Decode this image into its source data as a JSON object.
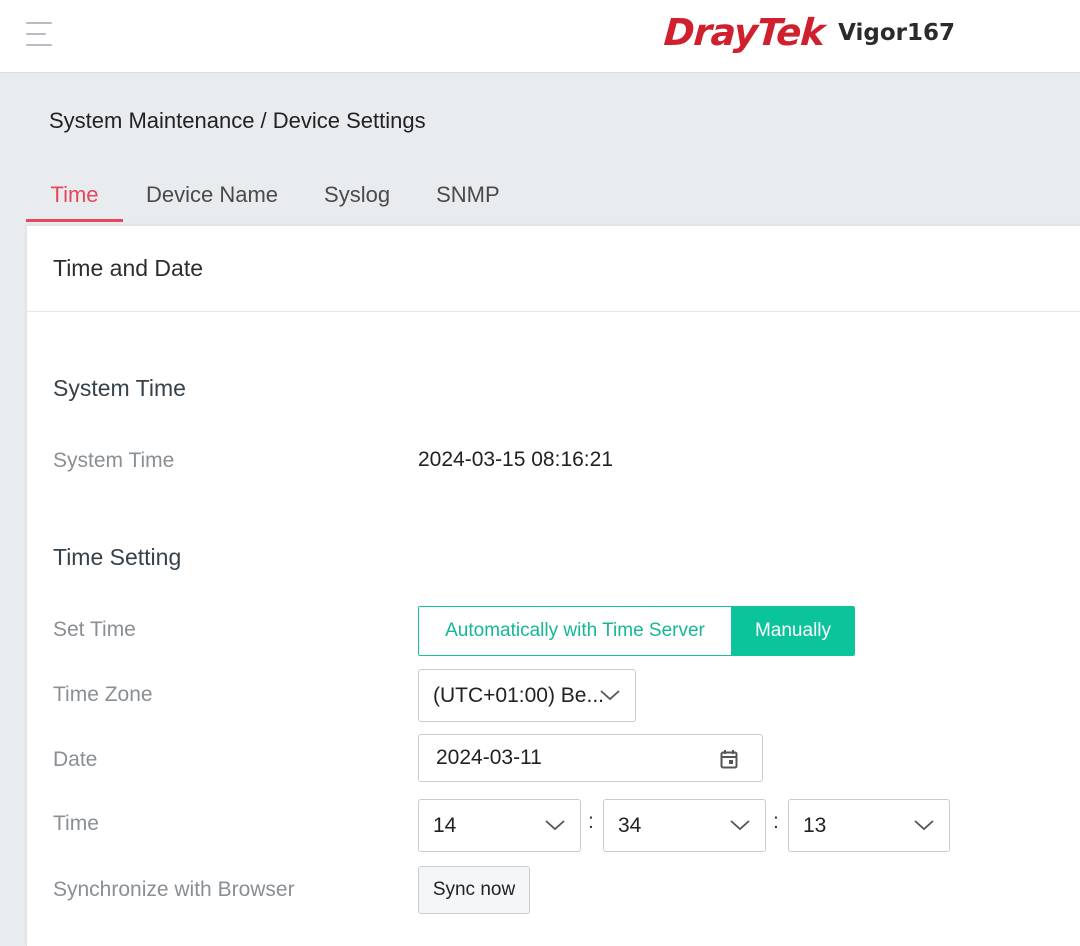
{
  "header": {
    "brand": "DrayTek",
    "model": "Vigor167",
    "brand_color": "#d0202e"
  },
  "breadcrumb": "System Maintenance / Device Settings",
  "tabs": [
    {
      "label": "Time",
      "active": true
    },
    {
      "label": "Device Name",
      "active": false
    },
    {
      "label": "Syslog",
      "active": false
    },
    {
      "label": "SNMP",
      "active": false
    }
  ],
  "panel": {
    "title": "Time and Date",
    "system_time_section": {
      "title": "System Time",
      "label": "System Time",
      "value": "2024-03-15 08:16:21"
    },
    "time_setting_section": {
      "title": "Time Setting",
      "set_time": {
        "label": "Set Time",
        "options": [
          "Automatically with Time Server",
          "Manually"
        ],
        "selected": "Manually"
      },
      "time_zone": {
        "label": "Time Zone",
        "value": "(UTC+01:00) Be..."
      },
      "date": {
        "label": "Date",
        "value": "2024-03-11"
      },
      "time": {
        "label": "Time",
        "hour": "14",
        "minute": "34",
        "second": "13",
        "separator": ":"
      },
      "sync": {
        "label": "Synchronize with Browser",
        "button": "Sync now"
      }
    }
  },
  "colors": {
    "accent_tab": "#e5485b",
    "accent_green": "#0cc49c"
  }
}
